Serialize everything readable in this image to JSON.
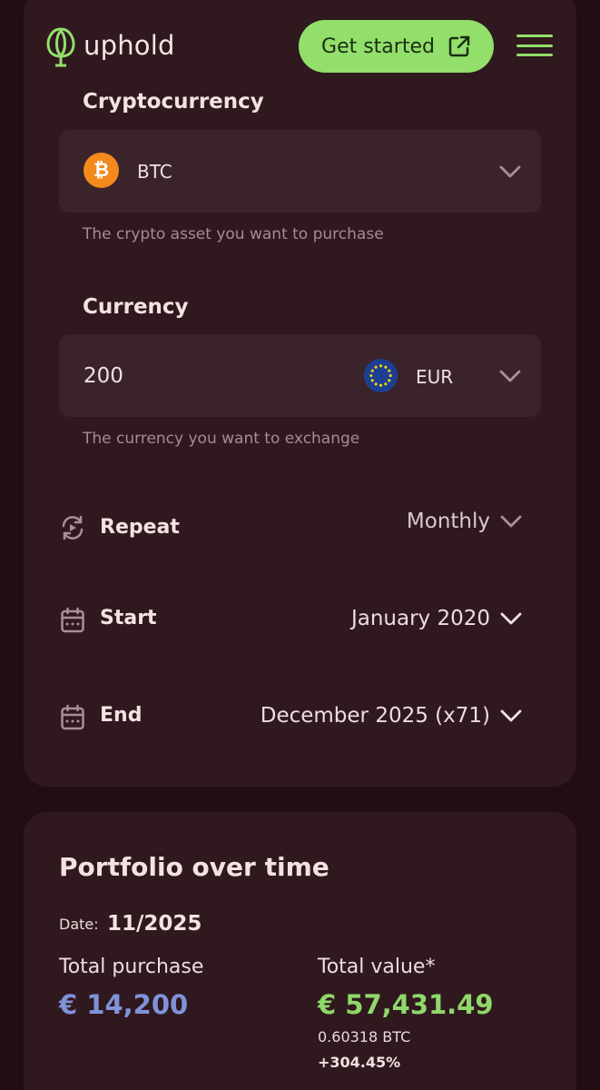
{
  "header": {
    "brand": "uphold",
    "cta_label": "Get started"
  },
  "form": {
    "crypto": {
      "label": "Cryptocurrency",
      "asset_symbol": "BTC",
      "helper": "The crypto asset you want to purchase"
    },
    "currency": {
      "label": "Currency",
      "amount": "200",
      "code": "EUR",
      "helper": "The currency you want to exchange"
    },
    "repeat": {
      "label": "Repeat",
      "value": "Monthly"
    },
    "start": {
      "label": "Start",
      "value": "January 2020"
    },
    "end": {
      "label": "End",
      "value": "December 2025 (x71)"
    }
  },
  "portfolio": {
    "title": "Portfolio over time",
    "date_label": "Date:",
    "date_value": "11/2025",
    "total_purchase_label": "Total purchase",
    "total_purchase_value": "€ 14,200",
    "total_value_label": "Total value*",
    "total_value_value": "€ 57,431.49",
    "btc_amount": "0.60318 BTC",
    "change_pct": "+304.45%"
  },
  "colors": {
    "background": "#230d14",
    "card": "#30181f",
    "field": "#3b232b",
    "accent_green": "#92df6c",
    "purchase_blue": "#7f93d8",
    "btc_orange": "#f28a1d"
  }
}
